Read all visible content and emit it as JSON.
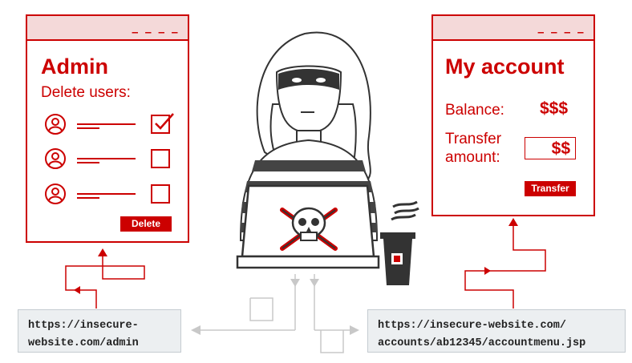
{
  "admin_panel": {
    "title": "Admin",
    "subtitle": "Delete users:",
    "users": [
      {
        "checked": true
      },
      {
        "checked": false
      },
      {
        "checked": false
      }
    ],
    "delete_label": "Delete",
    "dashes": "– – – –"
  },
  "account_panel": {
    "title": "My account",
    "balance_label": "Balance:",
    "balance_value": "$$$",
    "transfer_label_line1": "Transfer",
    "transfer_label_line2": "amount:",
    "transfer_value": "$$",
    "transfer_button": "Transfer",
    "dashes": "– – – –"
  },
  "urls": {
    "admin_line1": "https://insecure-",
    "admin_line2": "website.com/admin",
    "account_line1": "https://insecure-website.com/",
    "account_line2": "accounts/ab12345/accountmenu.jsp"
  },
  "colors": {
    "accent": "#cc0000",
    "panel_bar": "#f4d9d9",
    "url_bg": "#eceff1",
    "connector_gray": "#c8c8c8",
    "dark": "#333333"
  }
}
